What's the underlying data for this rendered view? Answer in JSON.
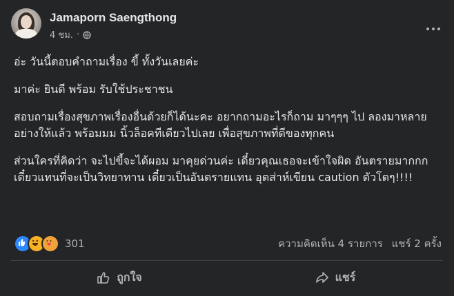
{
  "post": {
    "author": "Jamaporn Saengthong",
    "time": "4 ชม.",
    "separator": "·",
    "paragraphs": [
      "อ่ะ วันนี้ตอบคำถามเรื่อง ขี้ ทั้งวันเลยค่ะ",
      "มาค่ะ ยินดี พร้อม รับใช้ประชาชน",
      "สอบถามเรื่องสุขภาพเรื่องอื่นด้วยก็ได้นะคะ อยากถามอะไรก็ถาม มาๆๆๆ ไป ลองมาหลายอย่างให้แล้ว พร้อมมม นิ้วล็อคทีเดียวไปเลย เพื่อสุขภาพที่ดีของทุกคน",
      "ส่วนใครที่คิดว่า จะไปขี้จะได้ผอม มาคุยด่วนค่ะ เดี๋ยวคุณเธอจะเข้าใจผิด อันตรายมากกก เดี๋ยวแทนที่จะเป็นวิทยาทาน เดี๋ยวเป็นอันตรายแทน อุตส่าห์เขียน caution ตัวโตๆ!!!!"
    ]
  },
  "reactions": {
    "count": "301",
    "comments": "ความคิดเห็น 4 รายการ",
    "shares": "แชร์ 2 ครั้ง",
    "icons": [
      "like-icon",
      "haha-icon",
      "care-icon"
    ]
  },
  "actions": {
    "like_label": "ถูกใจ",
    "share_label": "แชร์"
  },
  "colors": {
    "background": "#242526",
    "text": "#e4e6eb",
    "secondary": "#b0b3b8",
    "like_blue": "#2d88ff",
    "reaction_yellow": "#f7b125"
  }
}
